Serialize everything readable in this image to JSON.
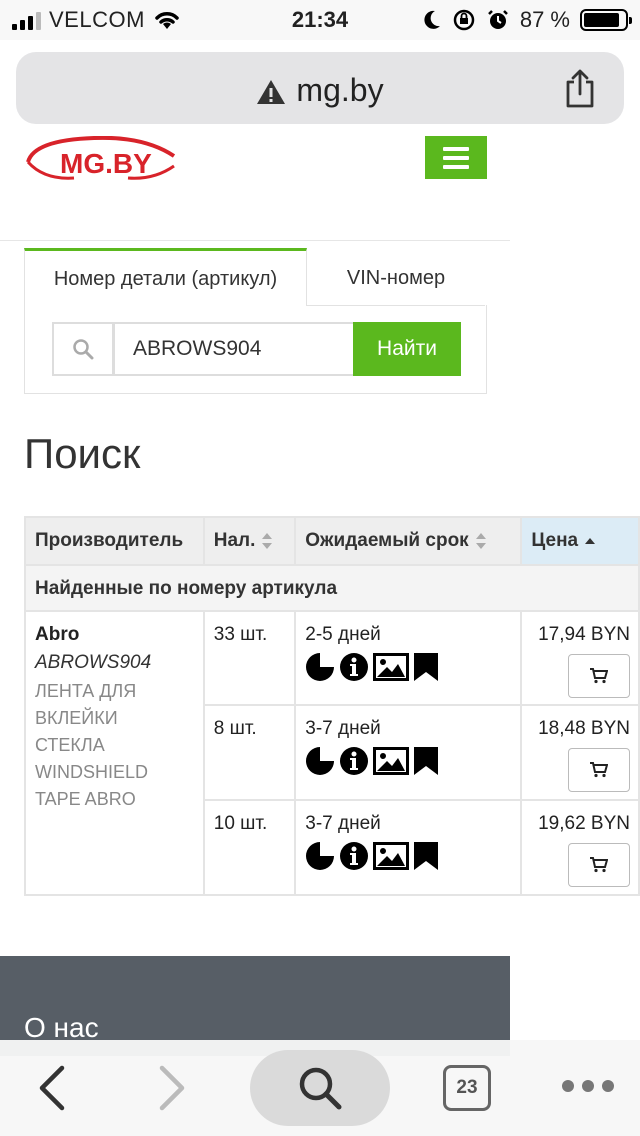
{
  "status_bar": {
    "carrier": "VELCOM",
    "time": "21:34",
    "battery_percent": "87 %"
  },
  "browser": {
    "url": "mg.by"
  },
  "site": {
    "logo_text": "MG.BY",
    "accent_color": "#5bb81e"
  },
  "search": {
    "tabs": [
      {
        "label": "Номер детали (артикул)",
        "active": true
      },
      {
        "label": "VIN-номер",
        "active": false
      }
    ],
    "input_value": "ABROWS904",
    "button_label": "Найти"
  },
  "page": {
    "title": "Поиск"
  },
  "table": {
    "headers": [
      "Производитель",
      "Нал.",
      "Ожидаемый срок",
      "Цена"
    ],
    "group_label": "Найденные по номеру артикула",
    "manufacturer": "Abro",
    "article": "ABROWS904",
    "description_lines": [
      "ЛЕНТА ДЛЯ",
      "ВКЛЕЙКИ",
      "СТЕКЛА",
      "WINDSHIELD",
      "TAPE ABRO"
    ],
    "offers": [
      {
        "qty": "33 шт.",
        "term": "2-5 дней",
        "price": "17,94 BYN"
      },
      {
        "qty": "8 шт.",
        "term": "3-7 дней",
        "price": "18,48 BYN"
      },
      {
        "qty": "10 шт.",
        "term": "3-7 дней",
        "price": "19,62 BYN"
      }
    ]
  },
  "footer": {
    "about": "О нас"
  },
  "toolbar": {
    "tabs_count": "23"
  }
}
